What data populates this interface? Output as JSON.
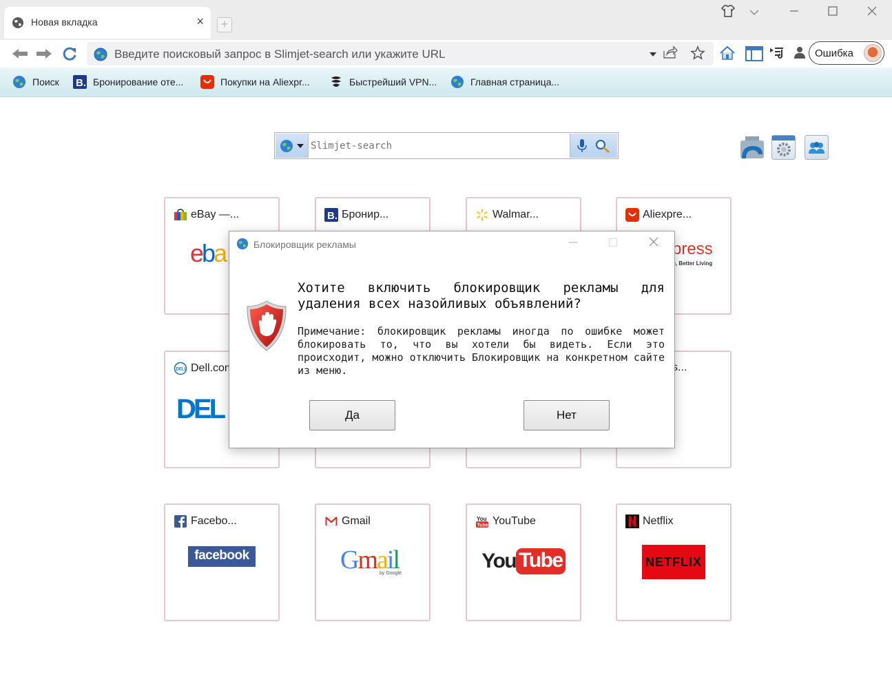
{
  "browser": {
    "tab_title": "Новая вкладка",
    "tab_close": "×",
    "new_tab": "+",
    "url_placeholder": "Введите поисковый запрос в Slimjet-search или укажите URL",
    "profile_status": "Ошибка"
  },
  "bookmarks": [
    {
      "label": "Поиск",
      "icon": "globe-icon"
    },
    {
      "label": "Бронирование оте...",
      "icon": "booking-icon"
    },
    {
      "label": "Покупки на Aliexpr...",
      "icon": "aliexpress-icon"
    },
    {
      "label": "Быстрейший VPN...",
      "icon": "vpn-icon"
    },
    {
      "label": "Главная страница...",
      "icon": "globe-icon"
    }
  ],
  "search": {
    "placeholder": "Slimjet-search"
  },
  "tiles": [
    {
      "title": "eBay —...",
      "logo": "ebay"
    },
    {
      "title": "Бронир...",
      "logo": ""
    },
    {
      "title": "Walmar...",
      "logo": ""
    },
    {
      "title": "Aliexpre...",
      "logo": "press",
      "tagline": "g, Better Living"
    },
    {
      "title": "Dell.com",
      "logo": "DELL"
    },
    {
      "title": "",
      "logo": ""
    },
    {
      "title": "",
      "logo": ""
    },
    {
      "title": "s...",
      "logo": ""
    },
    {
      "title": "Facebo...",
      "logo": "facebook"
    },
    {
      "title": "Gmail",
      "logo": "Gmail",
      "sublogo": "by Google"
    },
    {
      "title": "YouTube",
      "logo_you": "You",
      "logo_tube": "Tube"
    },
    {
      "title": "Netflix",
      "logo": "NETFLIX"
    }
  ],
  "dialog": {
    "title": "Блокировщик рекламы",
    "question": "Хотите включить блокировщик рекламы для удаления всех назойливых объявлений?",
    "note": "Примечание: блокировщик рекламы иногда по ошибке может блокировать то, что вы хотели бы видеть. Если это происходит, можно отключить Блокировщик на конкретном сайте из меню.",
    "yes_label": "Да",
    "no_label": "Нет"
  },
  "colors": {
    "tile_border": "#e5c7cf",
    "bookmarks_bar": "#d7ecf1",
    "ebay_red": "#e53238",
    "ebay_blue": "#0064d2",
    "dell_blue": "#0076ce",
    "facebook_blue": "#3b5998",
    "youtube_red": "#e52d27",
    "netflix_red": "#e50914"
  }
}
